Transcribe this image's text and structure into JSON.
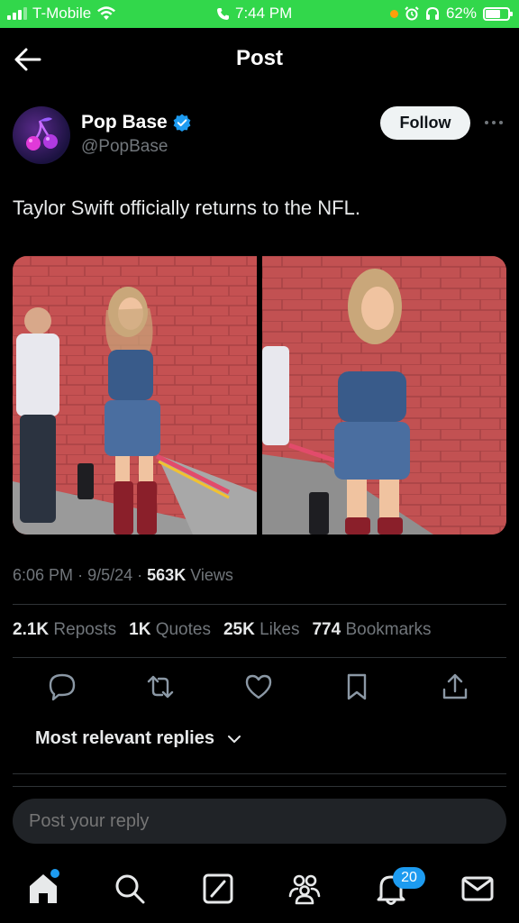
{
  "status_bar": {
    "carrier": "T-Mobile",
    "time": "7:44 PM",
    "battery": "62%",
    "icons": [
      "signal-icon",
      "wifi-icon",
      "phone-icon",
      "alarm-icon",
      "headphones-icon",
      "battery-icon"
    ]
  },
  "header": {
    "title": "Post"
  },
  "author": {
    "name": "Pop Base",
    "handle": "@PopBase",
    "verified": true,
    "follow_label": "Follow"
  },
  "post": {
    "text": "Taylor Swift officially returns to the NFL.",
    "time": "6:06 PM",
    "date": "9/5/24",
    "views_count": "563K",
    "views_label": "Views",
    "separator": "·"
  },
  "stats": {
    "reposts_count": "2.1K",
    "reposts_label": "Reposts",
    "quotes_count": "1K",
    "quotes_label": "Quotes",
    "likes_count": "25K",
    "likes_label": "Likes",
    "bookmarks_count": "774",
    "bookmarks_label": "Bookmarks"
  },
  "replies": {
    "sort_label": "Most relevant replies"
  },
  "composer": {
    "placeholder": "Post your reply"
  },
  "tabbar": {
    "items": [
      "home-icon",
      "search-icon",
      "grok-icon",
      "communities-icon",
      "notifications-icon",
      "messages-icon"
    ],
    "notifications_badge": "20"
  },
  "colors": {
    "accent": "#1d9bf0",
    "status_bar": "#32d74b",
    "background": "#000000"
  }
}
